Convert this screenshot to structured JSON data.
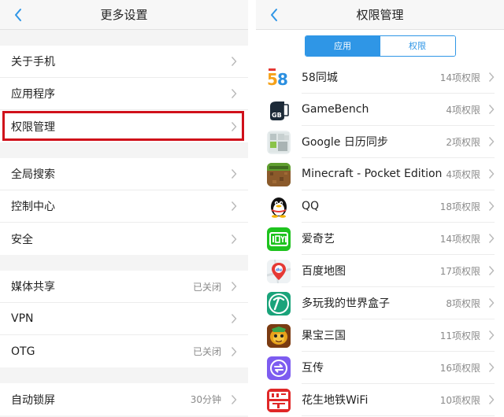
{
  "left": {
    "title": "更多设置",
    "groups": [
      [
        {
          "label": "关于手机"
        },
        {
          "label": "应用程序"
        },
        {
          "label": "权限管理"
        }
      ],
      [
        {
          "label": "全局搜索"
        },
        {
          "label": "控制中心"
        },
        {
          "label": "安全"
        }
      ],
      [
        {
          "label": "媒体共享",
          "value": "已关闭"
        },
        {
          "label": "VPN"
        },
        {
          "label": "OTG",
          "value": "已关闭"
        }
      ],
      [
        {
          "label": "自动锁屏",
          "value": "30分钟"
        }
      ]
    ]
  },
  "right": {
    "title": "权限管理",
    "tabs": [
      "应用",
      "权限"
    ],
    "active_tab": 0,
    "apps": [
      {
        "name": "58同城",
        "perm": "14项权限",
        "icon": "58-tongcheng-icon"
      },
      {
        "name": "GameBench",
        "perm": "4项权限",
        "icon": "gamebench-icon"
      },
      {
        "name": "Google 日历同步",
        "perm": "2项权限",
        "icon": "google-calendar-sync-icon"
      },
      {
        "name": "Minecraft - Pocket Edition",
        "perm": "4项权限",
        "icon": "minecraft-icon"
      },
      {
        "name": "QQ",
        "perm": "18项权限",
        "icon": "qq-penguin-icon"
      },
      {
        "name": "爱奇艺",
        "perm": "14项权限",
        "icon": "iqiyi-icon"
      },
      {
        "name": "百度地图",
        "perm": "17项权限",
        "icon": "baidu-map-icon"
      },
      {
        "name": "多玩我的世界盒子",
        "perm": "8项权限",
        "icon": "pickaxe-icon"
      },
      {
        "name": "果宝三国",
        "perm": "11项权限",
        "icon": "guobao-sanguo-icon"
      },
      {
        "name": "互传",
        "perm": "16项权限",
        "icon": "transfer-icon"
      },
      {
        "name": "花生地铁WiFi",
        "perm": "10项权限",
        "icon": "huasheng-wifi-icon"
      }
    ]
  },
  "colors": {
    "accent": "#2f96e6",
    "highlight": "#d0101a"
  }
}
